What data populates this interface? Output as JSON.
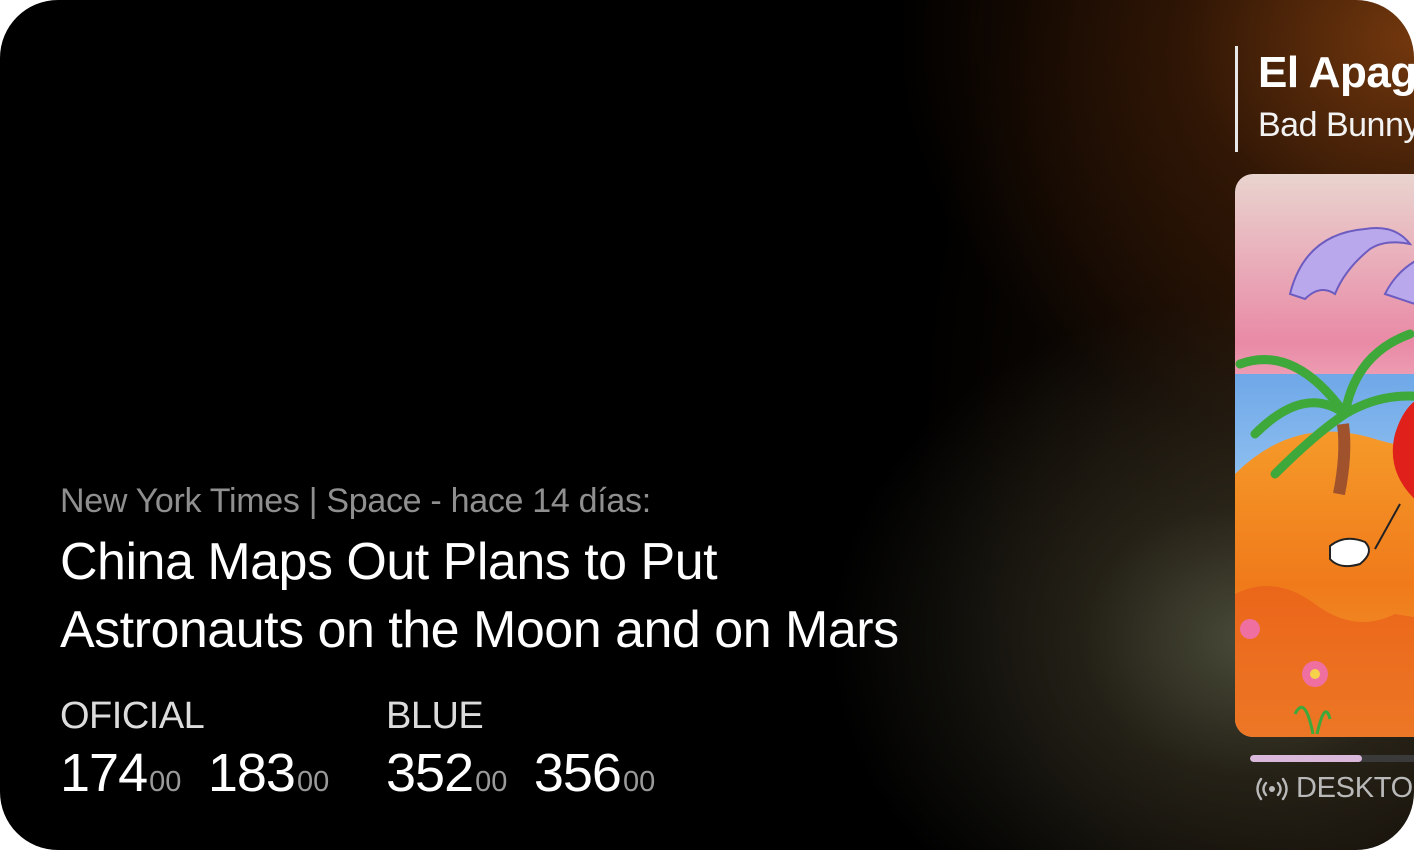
{
  "news": {
    "source": "New York Times | Space - hace 14 días:",
    "headline": "China Maps Out Plans to Put Astronauts on the Moon and on Mars"
  },
  "rates": {
    "oficial": {
      "label": "OFICIAL",
      "buy_int": "174",
      "buy_dec": "00",
      "sell_int": "183",
      "sell_dec": "00"
    },
    "blue": {
      "label": "BLUE",
      "buy_int": "352",
      "buy_dec": "00",
      "sell_int": "356",
      "sell_dec": "00"
    }
  },
  "music": {
    "title": "El Apagón",
    "artist": "Bad Bunny",
    "progress": 0.56,
    "device_icon": "broadcast-icon",
    "device": "DESKTOP"
  },
  "colors": {
    "accent_progress": "#d9b8dc",
    "secondary_text": "#8f8f8f"
  }
}
